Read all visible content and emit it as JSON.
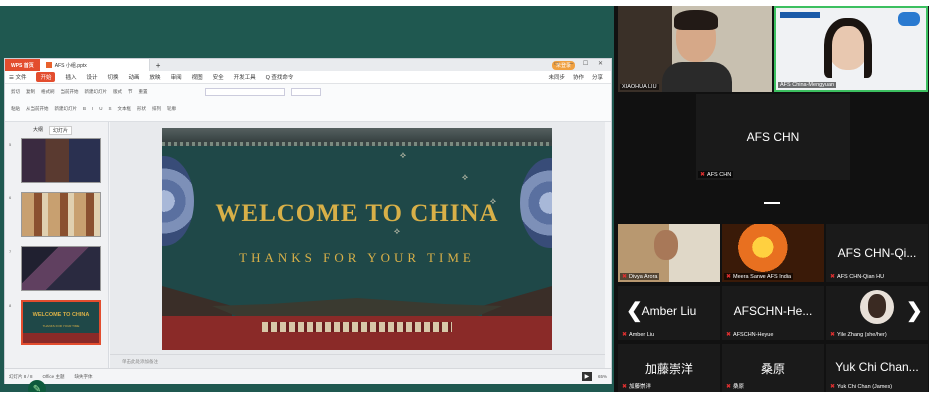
{
  "app": {
    "tab_home": "WPS 首页",
    "tab_doc": "AFS 小组.pptx",
    "tab_add": "+",
    "login": "未登录",
    "window_controls": "▭ ─ ☐ ✕"
  },
  "menu": {
    "file": "☰ 文件",
    "items": [
      "开始",
      "插入",
      "设计",
      "切换",
      "动画",
      "放映",
      "审阅",
      "视图",
      "安全",
      "开发工具",
      "Q 查找命令"
    ],
    "right": [
      "未同步",
      "协作",
      "分享"
    ]
  },
  "ribbon": {
    "row1": [
      "剪切",
      "复制",
      "格式刷",
      "当前开始",
      "新建幻灯片",
      "版式",
      "节",
      "重置"
    ],
    "row2": [
      "粘贴",
      "从当前开始",
      "新建幻灯片",
      "B",
      "I",
      "U",
      "S",
      "文本框",
      "形状",
      "排列",
      "轮廓"
    ]
  },
  "panel": {
    "tab_outline": "大纲",
    "tab_slides": "幻灯片",
    "thumb_numbers": [
      "5",
      "6",
      "7",
      "8"
    ],
    "thumb_last_title": "WELCOME TO CHINA",
    "thumb_last_sub": "THANKS FOR YOUR TIME"
  },
  "slide": {
    "title": "WELCOME TO CHINA",
    "subtitle": "THANKS FOR YOUR TIME"
  },
  "notes": "单击此处添加备注",
  "status": {
    "left": [
      "幻灯片 8 / 8",
      "Office 主题",
      "缺失字体"
    ],
    "zoom": "65%",
    "play": "▶"
  },
  "pen_icon": "✎",
  "participants": {
    "xiaohua": "XIAOHUA LIU",
    "mengyuan": "AFS China-Mengyuan",
    "afs_chn_big": "AFS CHN",
    "afs_chn": "AFS CHN",
    "divya": "Divya Arora",
    "meera": "Meera Sarwe AFS India",
    "qian_big": "AFS CHN-Qi...",
    "qian": "AFS CHN-Qian HU",
    "amber_big": "Amber Liu",
    "amber": "Amber Liu",
    "heyue_big": "AFSCHN-He...",
    "heyue": "AFSCHN-Heyue",
    "yile": "Yile Zhang (she/her)",
    "jia_big": "加藤崇洋",
    "jia": "加藤崇洋",
    "sang_big": "桑原",
    "sang": "桑原",
    "yuk_big": "Yuk Chi Chan...",
    "yuk": "Yuk Chi Chan (James)",
    "minimize": "—",
    "prev": "❮",
    "next": "❯",
    "mic_icon": "✖"
  }
}
